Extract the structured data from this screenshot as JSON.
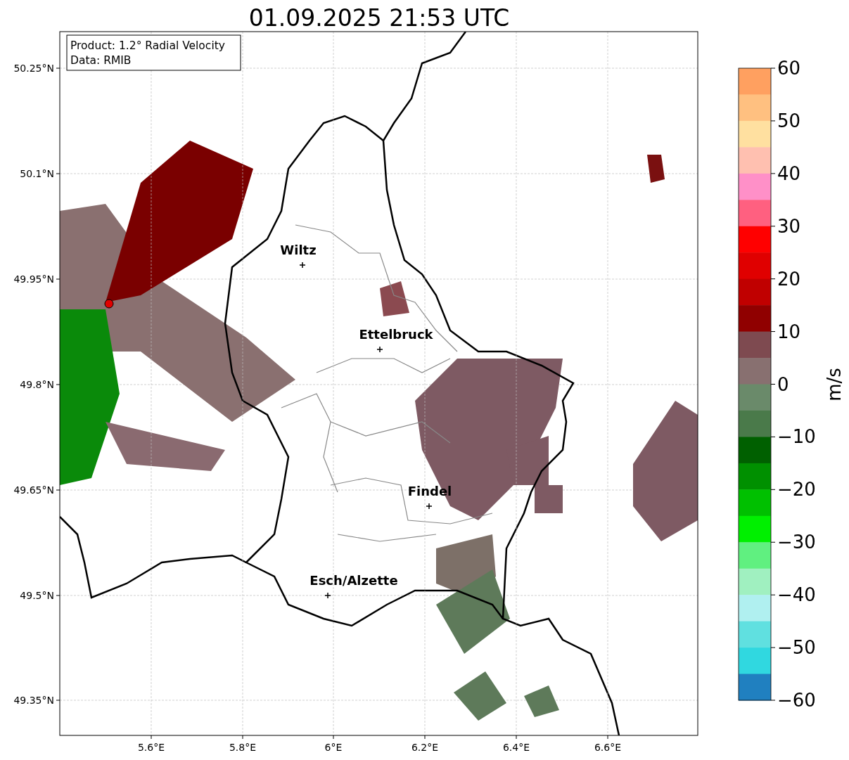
{
  "title": "01.09.2025 21:53 UTC",
  "info_box": [
    "Product: 1.2° Radial Velocity",
    "Data: RMIB"
  ],
  "y_axis_ticks": [
    "50.25°N",
    "50.1°N",
    "49.95°N",
    "49.8°N",
    "49.65°N",
    "49.5°N",
    "49.35°N"
  ],
  "x_axis_ticks": [
    "5.6°E",
    "5.8°E",
    "6°E",
    "6.2°E",
    "6.4°E",
    "6.6°E"
  ],
  "places": [
    {
      "name": "Wiltz"
    },
    {
      "name": "Ettelbruck"
    },
    {
      "name": "Findel"
    },
    {
      "name": "Esch/Alzette"
    }
  ],
  "colorbar": {
    "label": "m/s",
    "ticks": [
      "60",
      "50",
      "40",
      "30",
      "20",
      "10",
      "0",
      "−10",
      "−20",
      "−30",
      "−40",
      "−50",
      "−60"
    ]
  }
}
